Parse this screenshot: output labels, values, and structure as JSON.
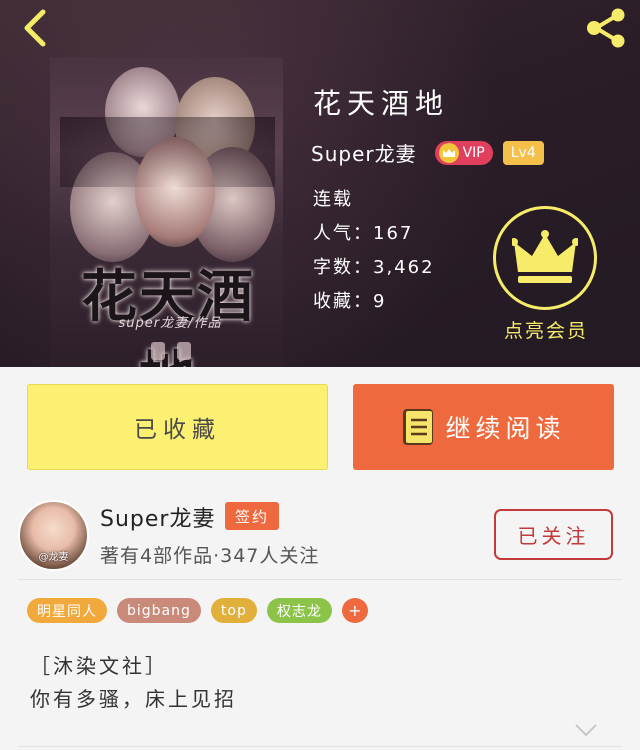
{
  "header": {
    "back_icon": "chevron-left-icon",
    "share_icon": "share-icon"
  },
  "book": {
    "title": "花天酒地",
    "cover_title": "花天酒地",
    "cover_subtitle": "super龙妻/作品",
    "author": "Super龙妻",
    "vip_label": "VIP",
    "level_label": "Lv4",
    "status": "连载",
    "popularity": "人气：167",
    "word_count": "字数：3,462",
    "favorites": "收藏：9"
  },
  "member": {
    "label": "点亮会员",
    "icon": "crown-icon"
  },
  "actions": {
    "favorite_label": "已收藏",
    "read_label": "继续阅读",
    "read_icon": "book-icon"
  },
  "author_card": {
    "name": "Super龙妻",
    "badge": "签约",
    "stats": "著有4部作品·347人关注",
    "follow_label": "已关注",
    "avatar_mark": "@龙妻"
  },
  "tags": [
    {
      "label": "明星同人",
      "color": "#f2a93b"
    },
    {
      "label": "bigbang",
      "color": "#c98a7a"
    },
    {
      "label": "top",
      "color": "#e0b03a"
    },
    {
      "label": "权志龙",
      "color": "#8cc44a"
    }
  ],
  "tag_plus": "+",
  "description": {
    "line1": "［沐染文社］",
    "line2": "你有多骚，床上见招"
  },
  "colors": {
    "accent_orange": "#ee6a3e",
    "accent_yellow": "#fbf071",
    "member_yellow": "#f7ec6a",
    "follow_red": "#c23a3a"
  }
}
